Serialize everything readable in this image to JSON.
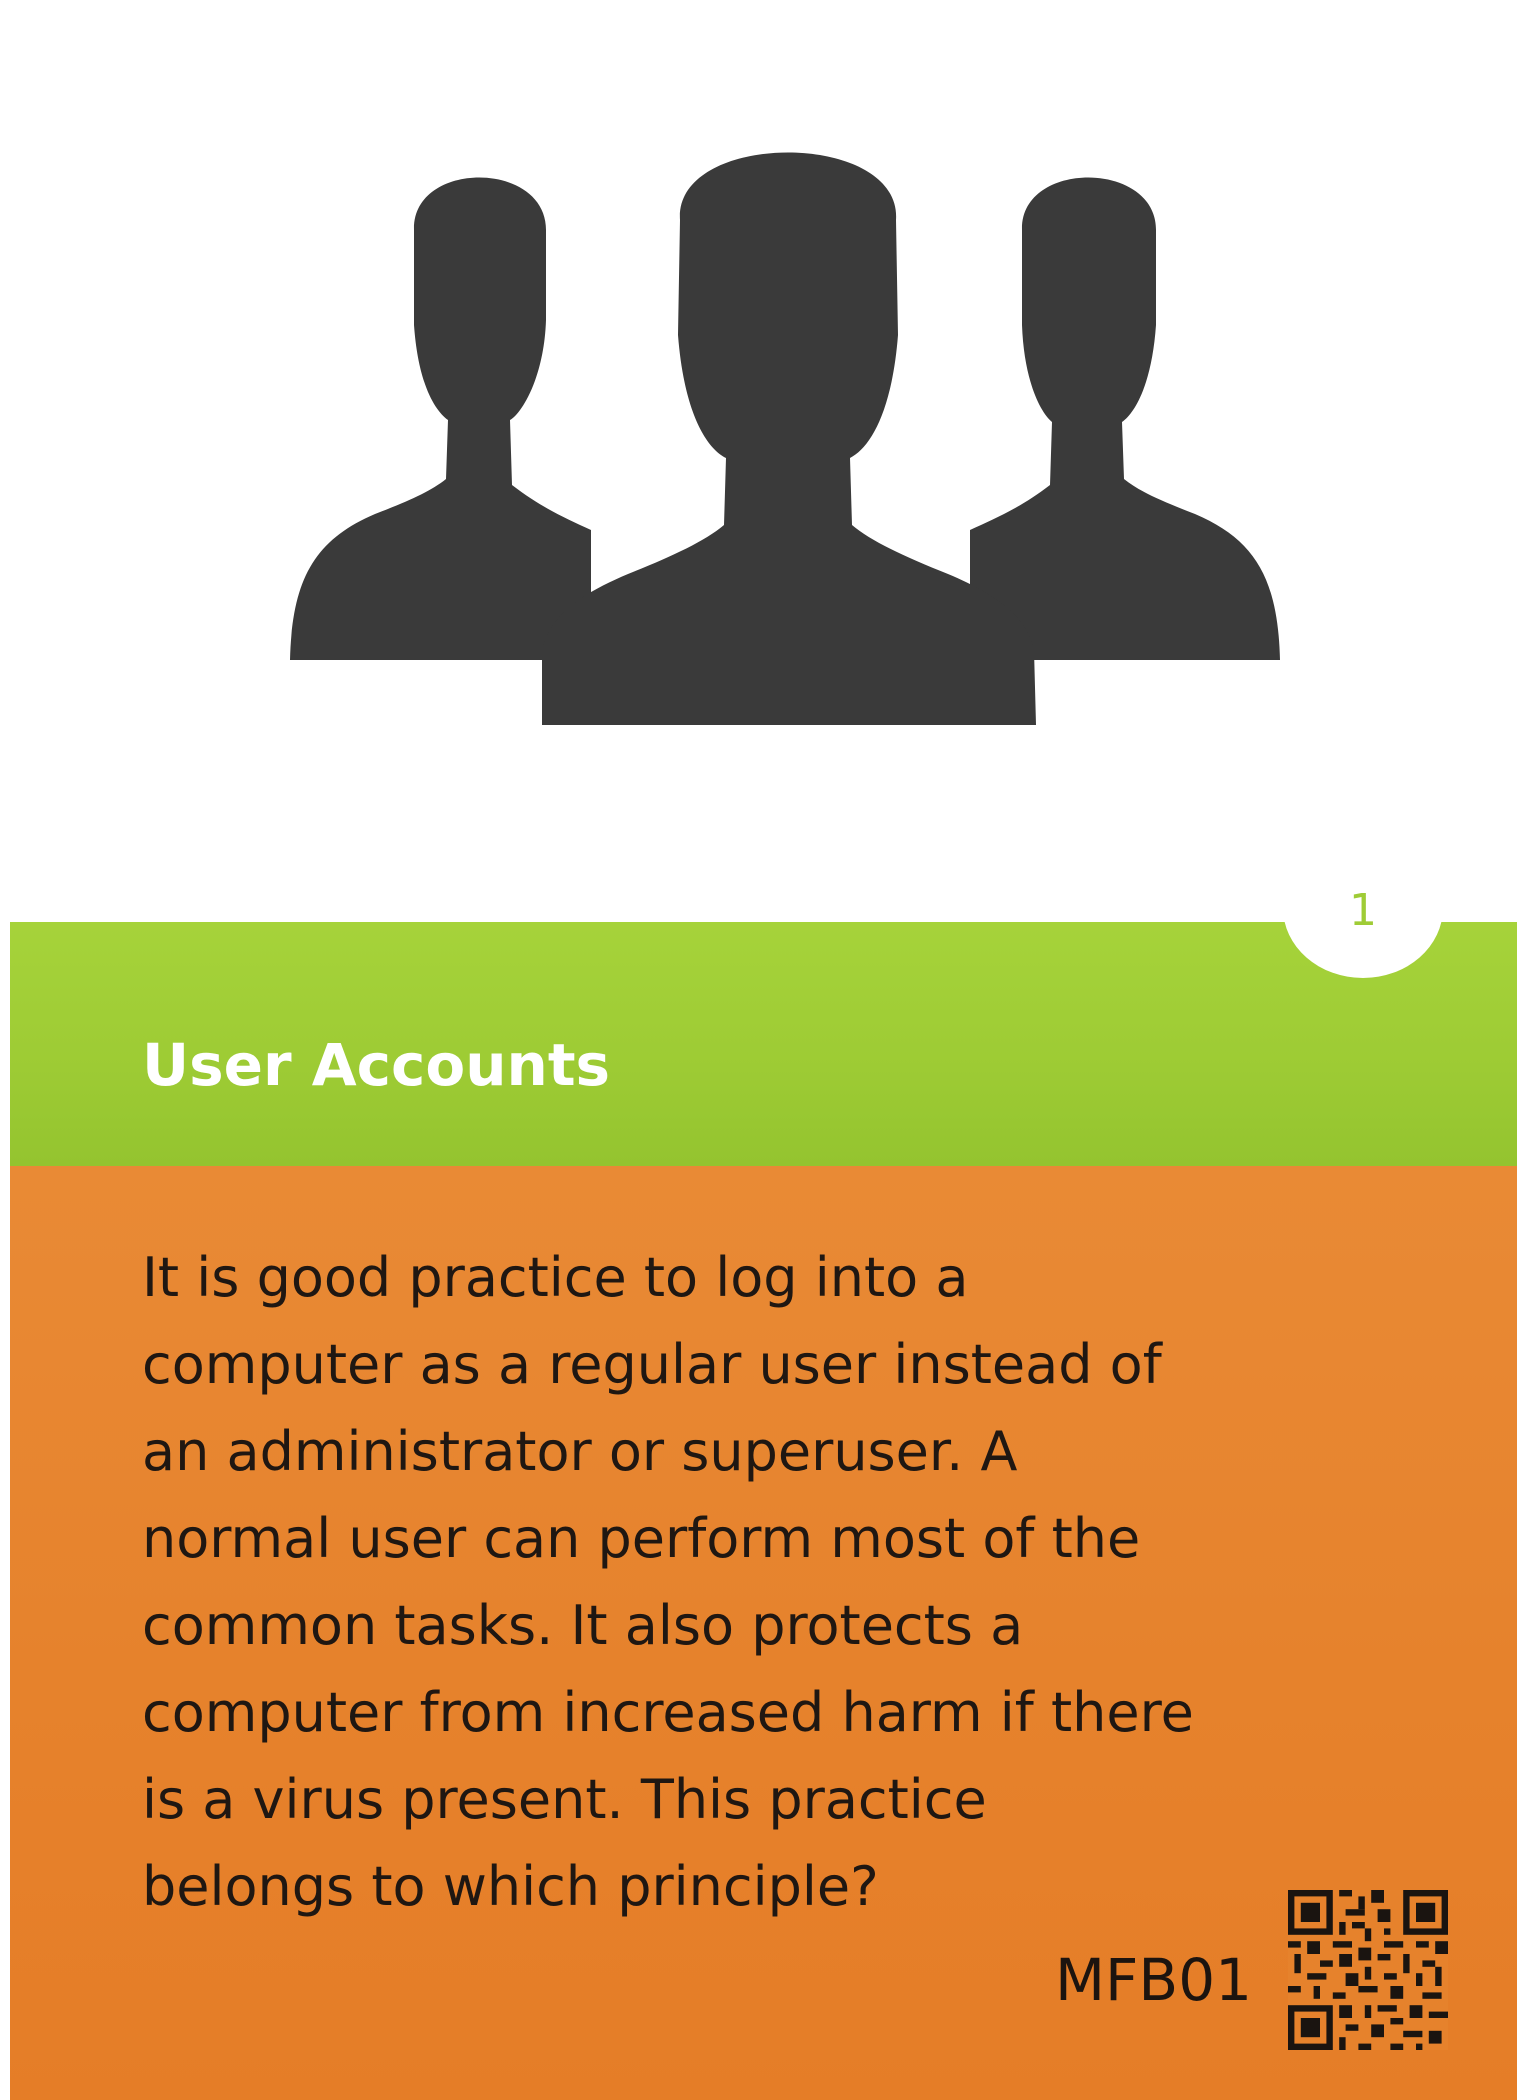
{
  "card": {
    "title": "User Accounts",
    "number": "1",
    "body_lines": [
      "It is good practice to log into a",
      "computer as a regular user instead of",
      "an administrator or superuser. A",
      "normal user can perform most of the",
      "common tasks. It also protects a",
      "computer from increased harm if there",
      "is a virus present. This practice",
      "belongs to which principle?"
    ],
    "code": "MFB01"
  },
  "icons": {
    "illustration": "users-group-icon",
    "qr": "qr-code-icon"
  },
  "colors": {
    "title_band": "#9dcb34",
    "body_band": "#e6822c",
    "silhouette": "#3a3a3a",
    "title_text": "#ffffff",
    "body_text": "#1f1712"
  }
}
